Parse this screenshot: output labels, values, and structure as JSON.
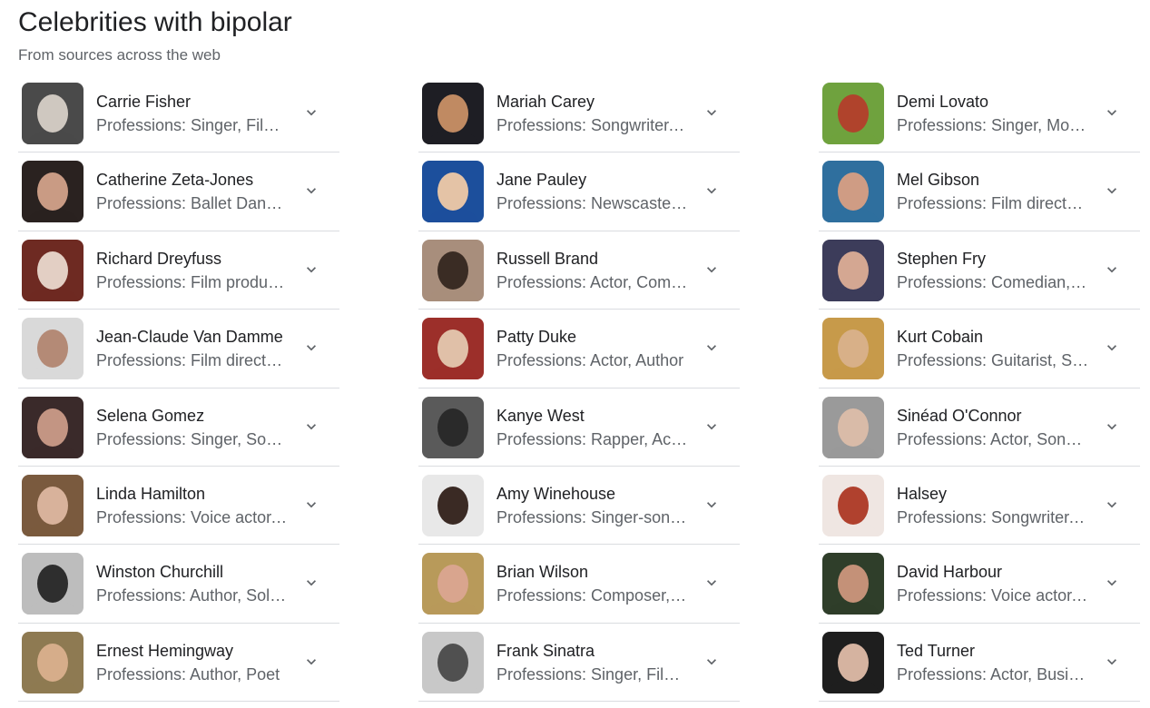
{
  "header": {
    "title": "Celebrities with bipolar",
    "subtitle": "From sources across the web"
  },
  "columns": [
    [
      {
        "name": "Carrie Fisher",
        "professions": "Professions: Singer, Film producer",
        "avatar_colors": [
          "#4a4a4a",
          "#cfc8c0"
        ]
      },
      {
        "name": "Catherine Zeta-Jones",
        "professions": "Professions: Ballet Dancer, Actor",
        "avatar_colors": [
          "#2a2220",
          "#c99b84"
        ]
      },
      {
        "name": "Richard Dreyfuss",
        "professions": "Professions: Film producer, Actor",
        "avatar_colors": [
          "#6e2a22",
          "#e3cfc4"
        ]
      },
      {
        "name": "Jean-Claude Van Damme",
        "professions": "Professions: Film director, Actor",
        "avatar_colors": [
          "#d9d9d9",
          "#b48a76"
        ]
      },
      {
        "name": "Selena Gomez",
        "professions": "Professions: Singer, Songwriter",
        "avatar_colors": [
          "#3a2a2a",
          "#c39583"
        ]
      },
      {
        "name": "Linda Hamilton",
        "professions": "Professions: Voice actor, Actor",
        "avatar_colors": [
          "#7a5a3e",
          "#d8b29b"
        ]
      },
      {
        "name": "Winston Churchill",
        "professions": "Professions: Author, Soldier",
        "avatar_colors": [
          "#bdbdbd",
          "#2e2e2e"
        ]
      },
      {
        "name": "Ernest Hemingway",
        "professions": "Professions: Author, Poet",
        "avatar_colors": [
          "#8e7a52",
          "#d6ad8a"
        ]
      }
    ],
    [
      {
        "name": "Mariah Carey",
        "professions": "Professions: Songwriter, Singer",
        "avatar_colors": [
          "#1e1e24",
          "#c08a62"
        ]
      },
      {
        "name": "Jane Pauley",
        "professions": "Professions: Newscaster, Journalist",
        "avatar_colors": [
          "#1c4f9c",
          "#e4c3a6"
        ]
      },
      {
        "name": "Russell Brand",
        "professions": "Professions: Actor, Comedian",
        "avatar_colors": [
          "#a88e7c",
          "#3a2c24"
        ]
      },
      {
        "name": "Patty Duke",
        "professions": "Professions: Actor, Author",
        "avatar_colors": [
          "#9c2f2a",
          "#e0c0a8"
        ]
      },
      {
        "name": "Kanye West",
        "professions": "Professions: Rapper, Actor",
        "avatar_colors": [
          "#5a5a5a",
          "#2a2a2a"
        ]
      },
      {
        "name": "Amy Winehouse",
        "professions": "Professions: Singer-songwriter",
        "avatar_colors": [
          "#e8e8e8",
          "#3a2a24"
        ]
      },
      {
        "name": "Brian Wilson",
        "professions": "Professions: Composer, Singer",
        "avatar_colors": [
          "#b89a5a",
          "#d9a58e"
        ]
      },
      {
        "name": "Frank Sinatra",
        "professions": "Professions: Singer, Film producer",
        "avatar_colors": [
          "#c8c8c8",
          "#505050"
        ]
      }
    ],
    [
      {
        "name": "Demi Lovato",
        "professions": "Professions: Singer, Model",
        "avatar_colors": [
          "#6fa23e",
          "#b0432c"
        ]
      },
      {
        "name": "Mel Gibson",
        "professions": "Professions: Film director, Actor",
        "avatar_colors": [
          "#2f6f9e",
          "#cf9c84"
        ]
      },
      {
        "name": "Stephen Fry",
        "professions": "Professions: Comedian, Actor",
        "avatar_colors": [
          "#3c3c5a",
          "#d4a792"
        ]
      },
      {
        "name": "Kurt Cobain",
        "professions": "Professions: Guitarist, Singer",
        "avatar_colors": [
          "#c79a4a",
          "#d8b088"
        ]
      },
      {
        "name": "Sinéad O'Connor",
        "professions": "Professions: Actor, Songwriter",
        "avatar_colors": [
          "#9a9a9a",
          "#d9bba8"
        ]
      },
      {
        "name": "Halsey",
        "professions": "Professions: Songwriter, Singer",
        "avatar_colors": [
          "#efe6e2",
          "#b0412e"
        ]
      },
      {
        "name": "David Harbour",
        "professions": "Professions: Voice actor, Actor",
        "avatar_colors": [
          "#2f3e2a",
          "#c49178"
        ]
      },
      {
        "name": "Ted Turner",
        "professions": "Professions: Actor, Businessperson",
        "avatar_colors": [
          "#1e1e1e",
          "#d5b3a0"
        ]
      }
    ]
  ],
  "icons": {
    "expand": "chevron-down-icon",
    "avatar": "person-photo-icon"
  },
  "colors": {
    "title": "#202124",
    "secondary_text": "#5f6368",
    "divider": "#dadce0",
    "chevron": "#5f6368"
  }
}
